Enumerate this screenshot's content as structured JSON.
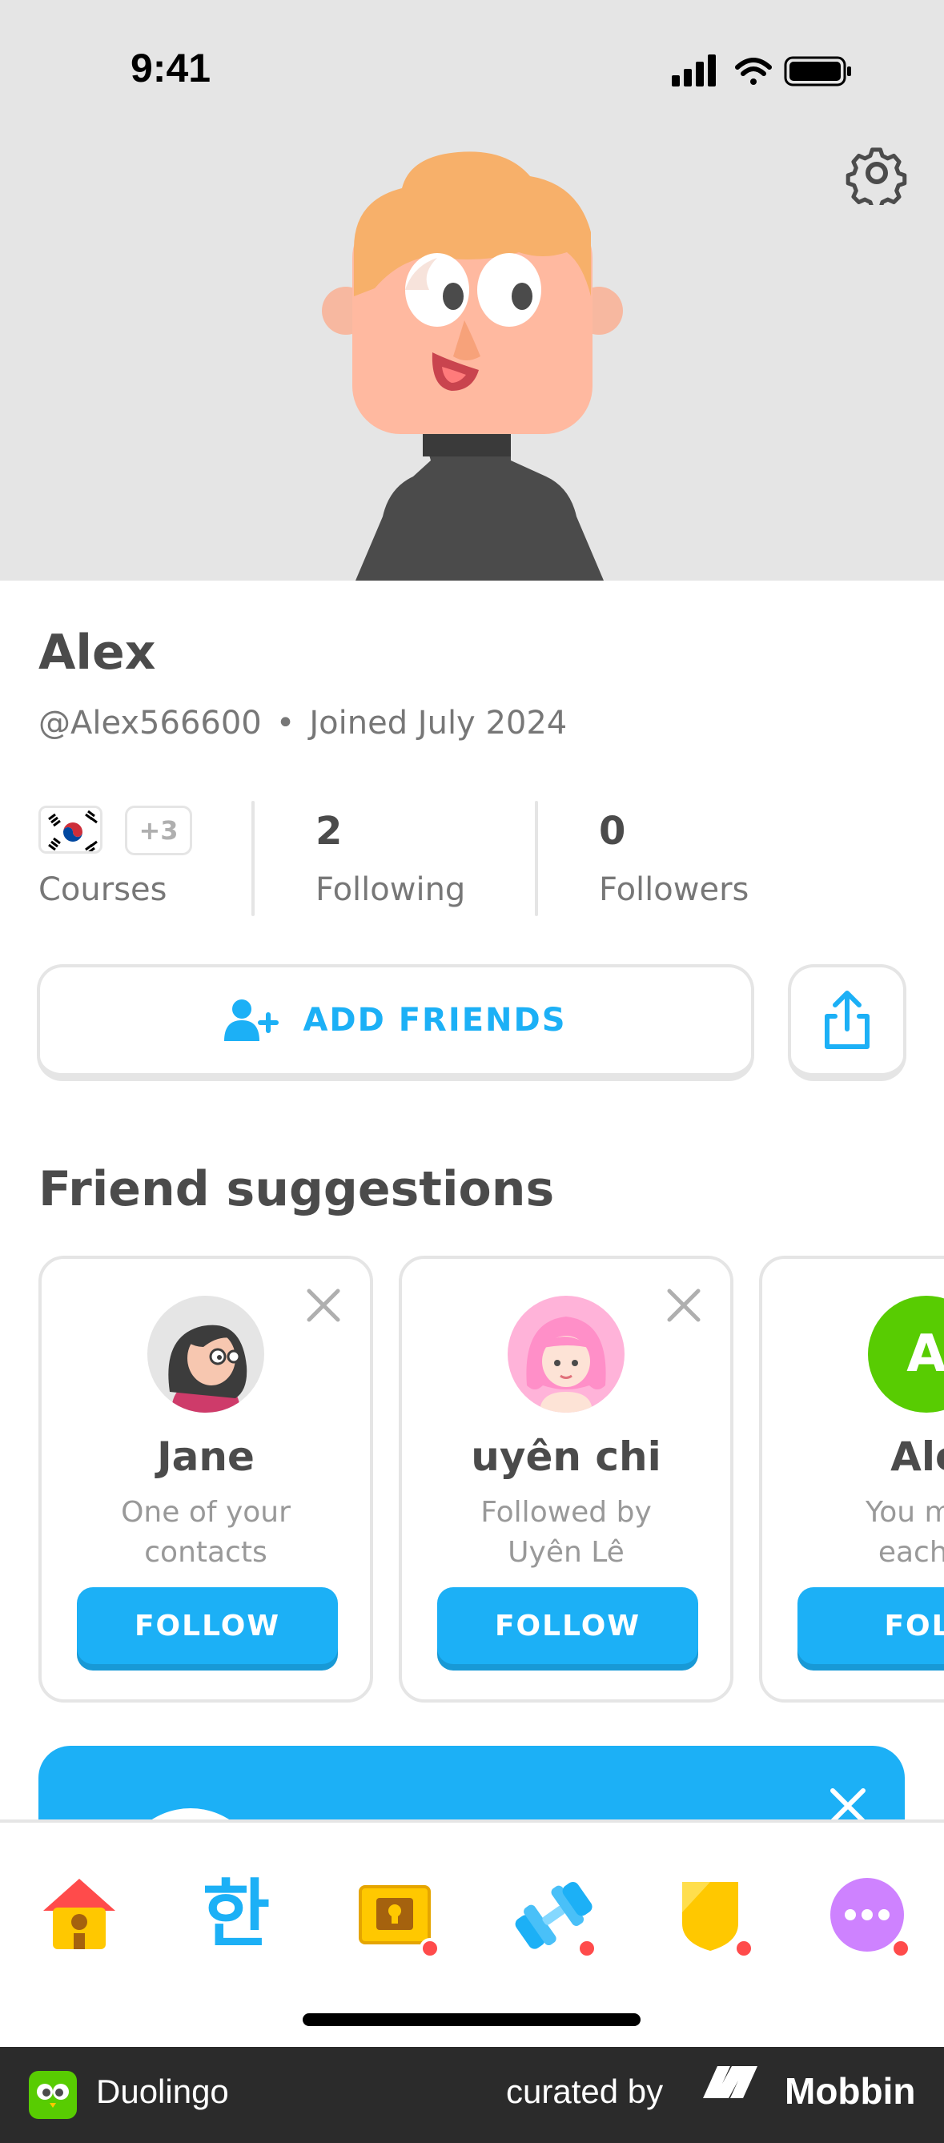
{
  "status_bar": {
    "time": "9:41"
  },
  "profile": {
    "name": "Alex",
    "username": "@Alex566600",
    "joined": "Joined July 2024"
  },
  "stats": {
    "courses_extra": "+3",
    "courses_label": "Courses",
    "following_count": "2",
    "following_label": "Following",
    "followers_count": "0",
    "followers_label": "Followers"
  },
  "actions": {
    "add_friends_label": "ADD FRIENDS"
  },
  "suggestions": {
    "title": "Friend suggestions",
    "cards": [
      {
        "name": "Jane",
        "subtitle_line1": "One of your",
        "subtitle_line2": "contacts",
        "button": "FOLLOW"
      },
      {
        "name": "uyên chi",
        "subtitle_line1": "Followed by",
        "subtitle_line2": "Uyên Lê",
        "button": "FOLLOW"
      },
      {
        "name": "Ale",
        "initial": "A",
        "subtitle_line1": "You may",
        "subtitle_line2": "each o",
        "button": "FOLL"
      }
    ]
  },
  "tabbar": {
    "items": [
      {
        "name": "home-tab",
        "icon": "house-icon"
      },
      {
        "name": "letters-tab",
        "icon": "hangul-icon",
        "glyph": "한"
      },
      {
        "name": "chest-tab",
        "icon": "treasure-chest-icon"
      },
      {
        "name": "practice-tab",
        "icon": "dumbbell-icon"
      },
      {
        "name": "leagues-tab",
        "icon": "shield-icon"
      },
      {
        "name": "more-tab",
        "icon": "more-icon"
      }
    ]
  },
  "footer": {
    "app_name": "Duolingo",
    "curated_by": "curated by",
    "brand": "Mobbin"
  },
  "colors": {
    "accent": "#1cb0f6",
    "text": "#4b4b4b",
    "muted": "#777777",
    "border": "#e5e5e5",
    "badge": "#ff4b4b"
  }
}
